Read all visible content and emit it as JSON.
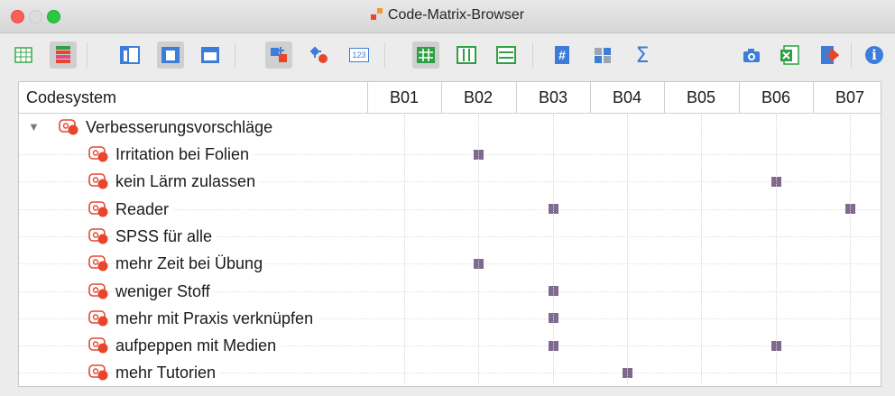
{
  "window": {
    "title": "Code-Matrix-Browser"
  },
  "toolbar": {
    "buttons": [
      {
        "name": "table-view-icon",
        "active": false
      },
      {
        "name": "heatmap-view-icon",
        "active": true
      },
      {
        "name": "layout-left-icon",
        "active": false
      },
      {
        "name": "layout-center-icon",
        "active": true
      },
      {
        "name": "layout-top-icon",
        "active": false
      },
      {
        "name": "symbol-squares-icon",
        "active": true
      },
      {
        "name": "symbol-circles-icon",
        "active": false
      },
      {
        "name": "numbers-icon",
        "active": false
      },
      {
        "name": "grid-rows-cols-icon",
        "active": true
      },
      {
        "name": "columns-icon",
        "active": false
      },
      {
        "name": "rows-icon",
        "active": false
      },
      {
        "name": "hash-icon",
        "active": false
      },
      {
        "name": "binary-icon",
        "active": false
      },
      {
        "name": "sum-icon",
        "active": false
      },
      {
        "name": "camera-icon",
        "active": false
      },
      {
        "name": "excel-export-icon",
        "active": false
      },
      {
        "name": "export-icon",
        "active": false
      },
      {
        "name": "info-icon",
        "active": false
      }
    ],
    "numbers_label": "123",
    "hash_label": "#",
    "sum_label": "Σ",
    "info_label": "i"
  },
  "matrix": {
    "header": "Codesystem",
    "columns": [
      "B01",
      "B02",
      "B03",
      "B04",
      "B05",
      "B06",
      "B07"
    ],
    "parent": "Verbesserungsvorschläge",
    "rows": [
      {
        "label": "Irritation bei Folien",
        "hits": [
          "B02"
        ]
      },
      {
        "label": "kein Lärm zulassen",
        "hits": [
          "B06"
        ]
      },
      {
        "label": "Reader",
        "hits": [
          "B03",
          "B07"
        ]
      },
      {
        "label": "SPSS für alle",
        "hits": []
      },
      {
        "label": "mehr Zeit bei Übung",
        "hits": [
          "B02"
        ]
      },
      {
        "label": "weniger Stoff",
        "hits": [
          "B03"
        ]
      },
      {
        "label": "mehr mit Praxis verknüpfen",
        "hits": [
          "B03"
        ]
      },
      {
        "label": "aufpeppen mit Medien",
        "hits": [
          "B03",
          "B06"
        ]
      },
      {
        "label": "mehr Tutorien",
        "hits": [
          "B04"
        ]
      }
    ]
  },
  "colors": {
    "hit": "#80698f",
    "code_icon": "#e8452c"
  }
}
